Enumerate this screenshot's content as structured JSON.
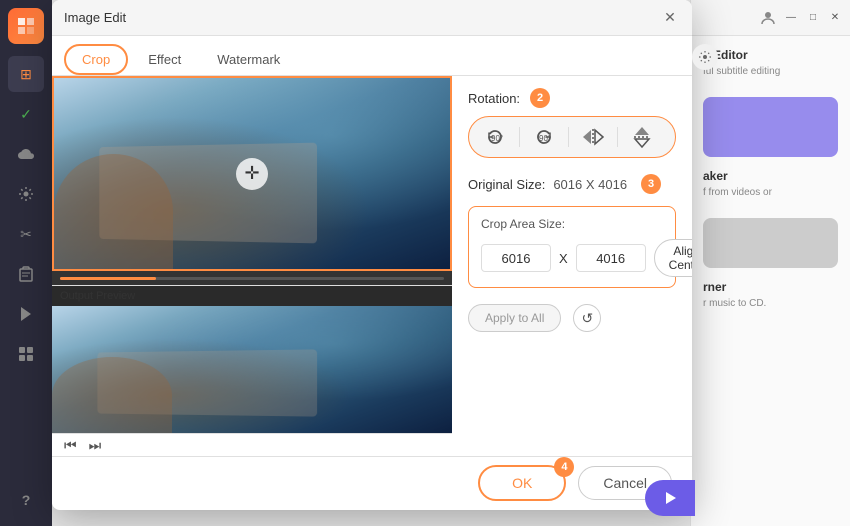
{
  "app": {
    "title": "Image Edit",
    "dialog_title": "Image Edit"
  },
  "tabs": [
    {
      "label": "Crop",
      "active": true
    },
    {
      "label": "Effect",
      "active": false
    },
    {
      "label": "Watermark",
      "active": false
    }
  ],
  "rotation": {
    "label": "Rotation:",
    "step_badge": "2",
    "buttons": [
      {
        "label": "↺90°",
        "icon": "rotate-left-90"
      },
      {
        "label": "↻90°",
        "icon": "rotate-right-90"
      },
      {
        "label": "⇔",
        "icon": "flip-horizontal"
      },
      {
        "label": "⇕",
        "icon": "flip-vertical"
      }
    ]
  },
  "original_size": {
    "label": "Original Size:",
    "value": "6016 X 4016",
    "step_badge": "3"
  },
  "crop_area": {
    "label": "Crop Area Size:",
    "width": "6016",
    "x_separator": "X",
    "height": "4016",
    "align_center_label": "Align Center"
  },
  "apply_row": {
    "apply_all_label": "Apply to All",
    "reset_icon": "↺"
  },
  "footer": {
    "ok_label": "OK",
    "cancel_label": "Cancel",
    "ok_step_badge": "4"
  },
  "preview": {
    "output_label": "Output Preview"
  },
  "playback": {
    "prev_icon": "⏮",
    "next_icon": "⏭"
  },
  "right_panel": {
    "editor_title": "e Editor",
    "editor_sub": "ful subtitle editing",
    "maker_title": "aker",
    "maker_sub": "f from videos or",
    "burner_title": "rner",
    "burner_sub": "r music to CD."
  },
  "sidebar": {
    "items": [
      {
        "icon": "⊞",
        "name": "home"
      },
      {
        "icon": "✓",
        "name": "check"
      },
      {
        "icon": "☁",
        "name": "cloud"
      },
      {
        "icon": "🔧",
        "name": "tools"
      },
      {
        "icon": "✂",
        "name": "edit"
      },
      {
        "icon": "📋",
        "name": "clipboard"
      },
      {
        "icon": "▶",
        "name": "play"
      },
      {
        "icon": "⊞",
        "name": "grid"
      },
      {
        "icon": "?",
        "name": "help"
      }
    ]
  },
  "colors": {
    "accent": "#ff8c42",
    "sidebar_bg": "#2b2b3b",
    "dialog_bg": "#ffffff"
  }
}
